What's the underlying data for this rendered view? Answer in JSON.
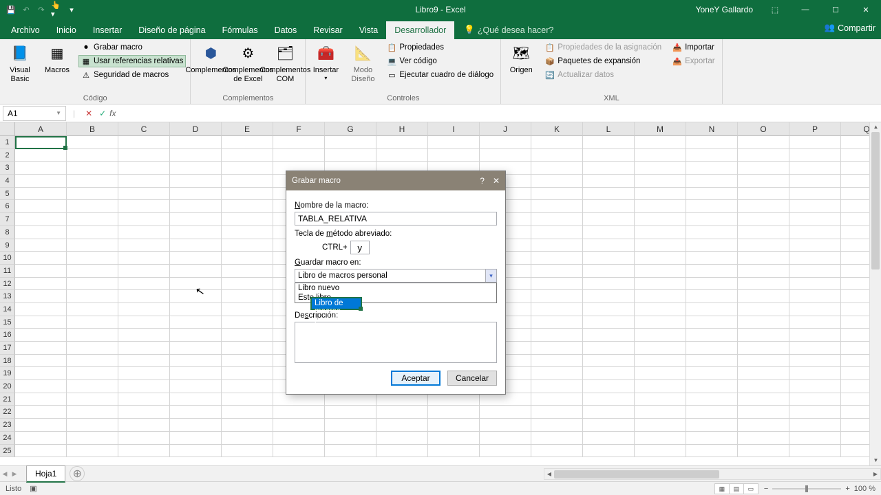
{
  "titlebar": {
    "title": "Libro9 - Excel",
    "user": "YoneY Gallardo"
  },
  "tabs": {
    "items": [
      "Archivo",
      "Inicio",
      "Insertar",
      "Diseño de página",
      "Fórmulas",
      "Datos",
      "Revisar",
      "Vista",
      "Desarrollador"
    ],
    "active": "Desarrollador",
    "tellme": "¿Qué desea hacer?",
    "share": "Compartir"
  },
  "ribbon": {
    "codigo": {
      "vb": "Visual Basic",
      "macros": "Macros",
      "grabar": "Grabar macro",
      "ref": "Usar referencias relativas",
      "seg": "Seguridad de macros",
      "label": "Código"
    },
    "compl": {
      "c1": "Complementos",
      "c2": "Complementos de Excel",
      "c3": "Complementos COM",
      "label": "Complementos"
    },
    "ctrl": {
      "ins": "Insertar",
      "modo": "Modo Diseño",
      "prop": "Propiedades",
      "ver": "Ver código",
      "cuadro": "Ejecutar cuadro de diálogo",
      "label": "Controles"
    },
    "xml": {
      "origen": "Origen",
      "propa": "Propiedades de la asignación",
      "paq": "Paquetes de expansión",
      "act": "Actualizar datos",
      "imp": "Importar",
      "exp": "Exportar",
      "label": "XML"
    }
  },
  "fbar": {
    "name": "A1"
  },
  "grid": {
    "cols": [
      "A",
      "B",
      "C",
      "D",
      "E",
      "F",
      "G",
      "H",
      "I",
      "J",
      "K",
      "L",
      "M",
      "N",
      "O",
      "P",
      "Q"
    ],
    "rows": 25
  },
  "sheets": {
    "s1": "Hoja1"
  },
  "status": {
    "ready": "Listo",
    "zoom": "100 %"
  },
  "dialog": {
    "title": "Grabar macro",
    "lbl_nombre": "Nombre de la macro:",
    "nombre_val": "TABLA_RELATIVA",
    "lbl_tecla": "Tecla de método abreviado:",
    "ctrl": "CTRL+",
    "key_val": "y",
    "lbl_guardar": "Guardar macro en:",
    "combo_val": "Libro de macros personal",
    "opts": [
      "Libro de macros personal",
      "Libro nuevo",
      "Este libro"
    ],
    "lbl_desc": "Descripción:",
    "aceptar": "Aceptar",
    "cancelar": "Cancelar"
  }
}
